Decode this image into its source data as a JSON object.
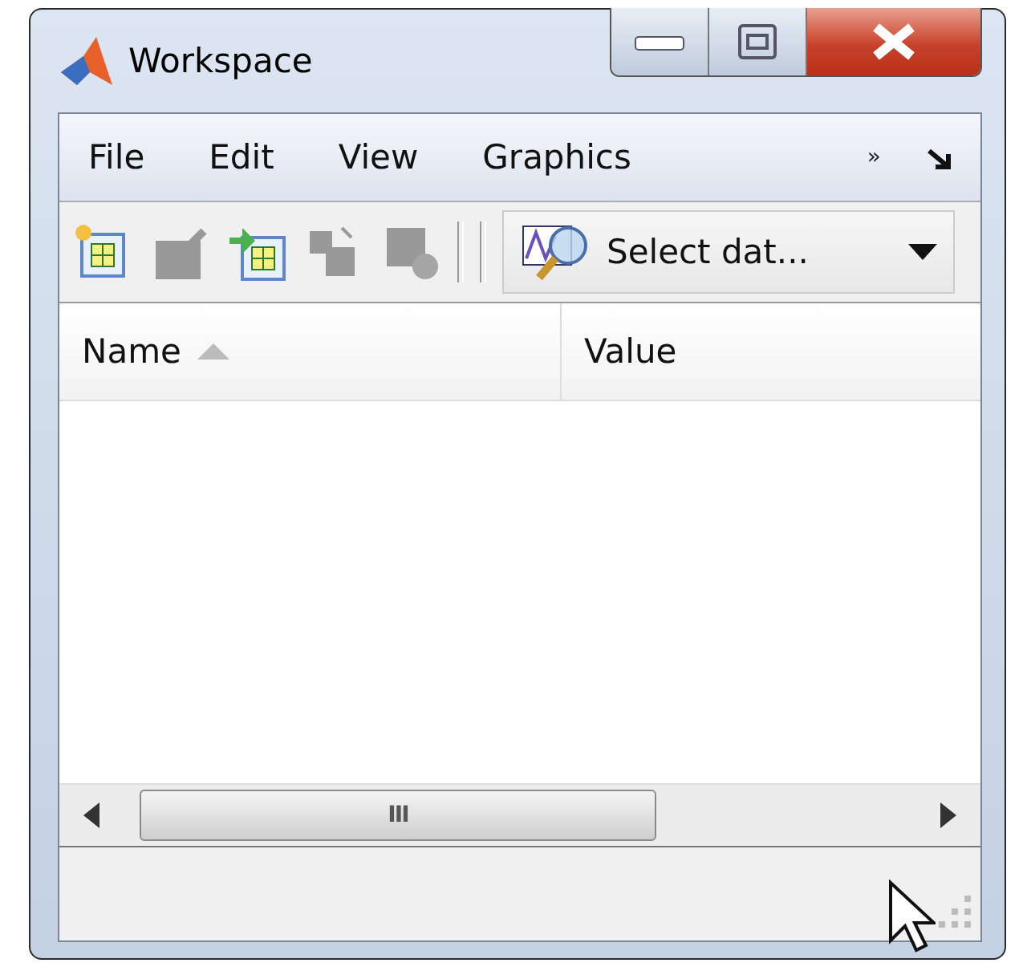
{
  "window": {
    "title": "Workspace"
  },
  "menu": [
    {
      "label": "File"
    },
    {
      "label": "Edit"
    },
    {
      "label": "View"
    },
    {
      "label": "Graphics"
    }
  ],
  "menu_overflow": "»",
  "toolbar": [
    {
      "kind": "new-variable",
      "disabled": false
    },
    {
      "kind": "open",
      "disabled": true
    },
    {
      "kind": "import",
      "disabled": false
    },
    {
      "kind": "save",
      "disabled": true
    },
    {
      "kind": "delete",
      "disabled": true
    }
  ],
  "select_data": {
    "label": "Select dat..."
  },
  "table": {
    "columns": [
      {
        "label": "Name",
        "sorted": true
      },
      {
        "label": "Value",
        "sorted": false
      }
    ]
  },
  "scrollbar_grip": "III"
}
